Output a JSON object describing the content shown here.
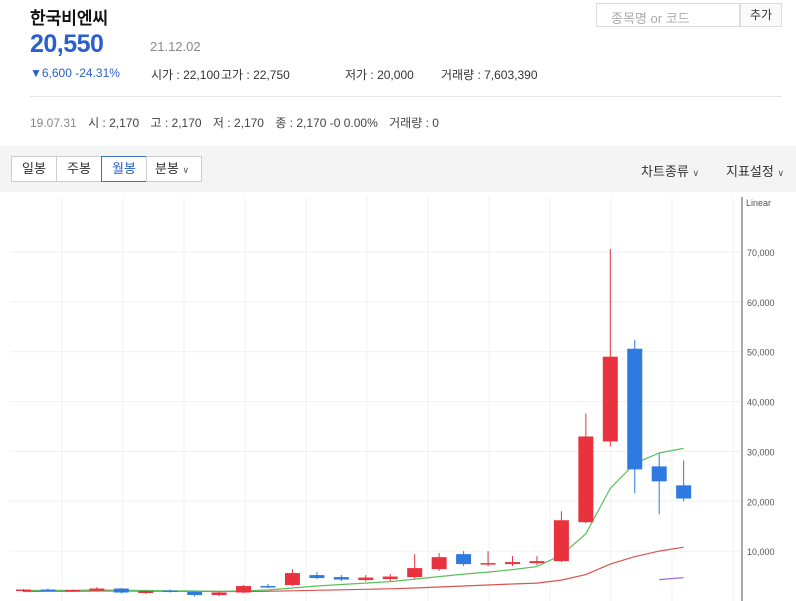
{
  "header": {
    "stock_name": "한국비엔씨",
    "price": "20,550",
    "date": "21.12.02",
    "change": "▼6,600 -24.31%",
    "ohlc": [
      {
        "label": "시가 : 22,100"
      },
      {
        "label": "고가 : 22,750"
      },
      {
        "label": "저가 : 20,000"
      },
      {
        "label": "거래량 : 7,603,390"
      }
    ]
  },
  "search": {
    "placeholder": "종목명 or 코드",
    "add_label": "추가"
  },
  "history": {
    "date": "19.07.31",
    "open": "시 : 2,170",
    "high": "고 : 2,170",
    "low": "저 : 2,170",
    "close": "종 : 2,170 -0 0.00%",
    "volume": "거래량 : 0"
  },
  "toolbar": {
    "tabs": [
      "일봉",
      "주봉",
      "월봉",
      "분봉"
    ],
    "active_tab": "월봉",
    "chart_type_label": "차트종류",
    "indicator_label": "지표설정"
  },
  "colors": {
    "up": "#e8333f",
    "down": "#2f7ae0",
    "ma_green": "#5bbf5b",
    "ma_red": "#d9534f",
    "ma_purple": "#9b6fd6",
    "accent": "#2b5fd0"
  },
  "chart_data": {
    "type": "candlestick",
    "scale_label": "Linear",
    "ylim": [
      0,
      76000
    ],
    "yticks": [
      "10,000",
      "20,000",
      "30,000",
      "40,000",
      "50,000",
      "60,000",
      "70,000"
    ],
    "candles": [
      {
        "o": 2000,
        "h": 2400,
        "l": 1800,
        "c": 2300
      },
      {
        "o": 2300,
        "h": 2500,
        "l": 2000,
        "c": 2100
      },
      {
        "o": 2100,
        "h": 2300,
        "l": 1900,
        "c": 2200
      },
      {
        "o": 2100,
        "h": 2800,
        "l": 1900,
        "c": 2500
      },
      {
        "o": 2500,
        "h": 2600,
        "l": 1500,
        "c": 1700
      },
      {
        "o": 1600,
        "h": 2200,
        "l": 1400,
        "c": 2000
      },
      {
        "o": 2100,
        "h": 2300,
        "l": 1700,
        "c": 1800
      },
      {
        "o": 1800,
        "h": 2000,
        "l": 900,
        "c": 1200
      },
      {
        "o": 1200,
        "h": 2000,
        "l": 1000,
        "c": 1700
      },
      {
        "o": 1700,
        "h": 3200,
        "l": 1600,
        "c": 3000
      },
      {
        "o": 3000,
        "h": 3400,
        "l": 2600,
        "c": 2700
      },
      {
        "o": 3200,
        "h": 6400,
        "l": 3000,
        "c": 5600
      },
      {
        "o": 5200,
        "h": 5800,
        "l": 4400,
        "c": 4600
      },
      {
        "o": 4800,
        "h": 5200,
        "l": 4000,
        "c": 4300
      },
      {
        "o": 4200,
        "h": 5200,
        "l": 3900,
        "c": 4700
      },
      {
        "o": 4400,
        "h": 5400,
        "l": 4000,
        "c": 4900
      },
      {
        "o": 4800,
        "h": 9400,
        "l": 4500,
        "c": 6600
      },
      {
        "o": 6400,
        "h": 9600,
        "l": 6000,
        "c": 8800
      },
      {
        "o": 9400,
        "h": 10000,
        "l": 7000,
        "c": 7400
      },
      {
        "o": 7400,
        "h": 10000,
        "l": 7000,
        "c": 7600
      },
      {
        "o": 7400,
        "h": 9000,
        "l": 7000,
        "c": 7800
      },
      {
        "o": 7600,
        "h": 9000,
        "l": 7200,
        "c": 8000
      },
      {
        "o": 8000,
        "h": 18000,
        "l": 7800,
        "c": 16200
      },
      {
        "o": 15800,
        "h": 37600,
        "l": 15600,
        "c": 33000
      },
      {
        "o": 32000,
        "h": 70600,
        "l": 31000,
        "c": 49000
      },
      {
        "o": 50600,
        "h": 52400,
        "l": 21600,
        "c": 26400
      },
      {
        "o": 27000,
        "h": 29600,
        "l": 17400,
        "c": 24000
      },
      {
        "o": 23200,
        "h": 28200,
        "l": 20000,
        "c": 20550
      }
    ],
    "ma_green": [
      2100,
      2150,
      2150,
      2200,
      2150,
      2100,
      2050,
      2000,
      1950,
      2050,
      2200,
      2600,
      3000,
      3300,
      3600,
      3900,
      4400,
      4900,
      5400,
      5800,
      6300,
      6900,
      9200,
      13500,
      22600,
      27600,
      29700,
      30600
    ],
    "ma_red": [
      1900,
      1950,
      1950,
      2000,
      2000,
      1980,
      1950,
      1920,
      1900,
      1900,
      1950,
      2050,
      2150,
      2250,
      2350,
      2450,
      2600,
      2800,
      3000,
      3200,
      3400,
      3600,
      4200,
      5300,
      7400,
      8900,
      10000,
      10800
    ],
    "ma_purple": [
      null,
      null,
      null,
      null,
      null,
      null,
      null,
      null,
      null,
      null,
      null,
      null,
      null,
      null,
      null,
      null,
      null,
      null,
      null,
      null,
      null,
      null,
      null,
      null,
      null,
      null,
      4300,
      4700
    ]
  }
}
